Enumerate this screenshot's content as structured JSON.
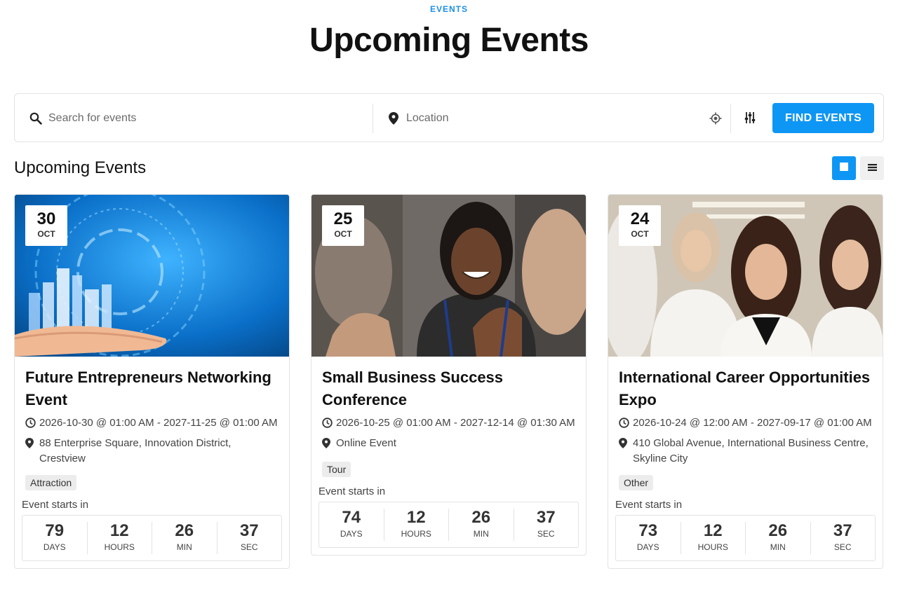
{
  "header": {
    "kicker": "EVENTS",
    "title": "Upcoming Events"
  },
  "search": {
    "search_placeholder": "Search for events",
    "location_placeholder": "Location",
    "find_label": "FIND EVENTS",
    "accent_color": "#0e96f4"
  },
  "section": {
    "title": "Upcoming Events",
    "view_grid_icon": "grid-view-icon",
    "view_list_icon": "list-view-icon"
  },
  "events": [
    {
      "day": "30",
      "month": "OCT",
      "title": "Future Entrepreneurs Networking Event",
      "datetime": "2026-10-30 @ 01:00 AM - 2027-11-25 @ 01:00 AM",
      "location": "88 Enterprise Square, Innovation District, Crestview",
      "tag": "Attraction",
      "starts_label": "Event starts in",
      "countdown": [
        {
          "value": "79",
          "unit": "DAYS"
        },
        {
          "value": "12",
          "unit": "HOURS"
        },
        {
          "value": "26",
          "unit": "MIN"
        },
        {
          "value": "37",
          "unit": "SEC"
        }
      ]
    },
    {
      "day": "25",
      "month": "OCT",
      "title": "Small Business Success Conference",
      "datetime": "2026-10-25 @ 01:00 AM - 2027-12-14 @ 01:30 AM",
      "location": "Online Event",
      "tag": "Tour",
      "starts_label": "Event starts in",
      "countdown": [
        {
          "value": "74",
          "unit": "DAYS"
        },
        {
          "value": "12",
          "unit": "HOURS"
        },
        {
          "value": "26",
          "unit": "MIN"
        },
        {
          "value": "37",
          "unit": "SEC"
        }
      ]
    },
    {
      "day": "24",
      "month": "OCT",
      "title": "International Career Opportunities Expo",
      "datetime": "2026-10-24 @ 12:00 AM - 2027-09-17 @ 01:00 AM",
      "location": "410 Global Avenue, International Business Centre, Skyline City",
      "tag": "Other",
      "starts_label": "Event starts in",
      "countdown": [
        {
          "value": "73",
          "unit": "DAYS"
        },
        {
          "value": "12",
          "unit": "HOURS"
        },
        {
          "value": "26",
          "unit": "MIN"
        },
        {
          "value": "37",
          "unit": "SEC"
        }
      ]
    }
  ]
}
